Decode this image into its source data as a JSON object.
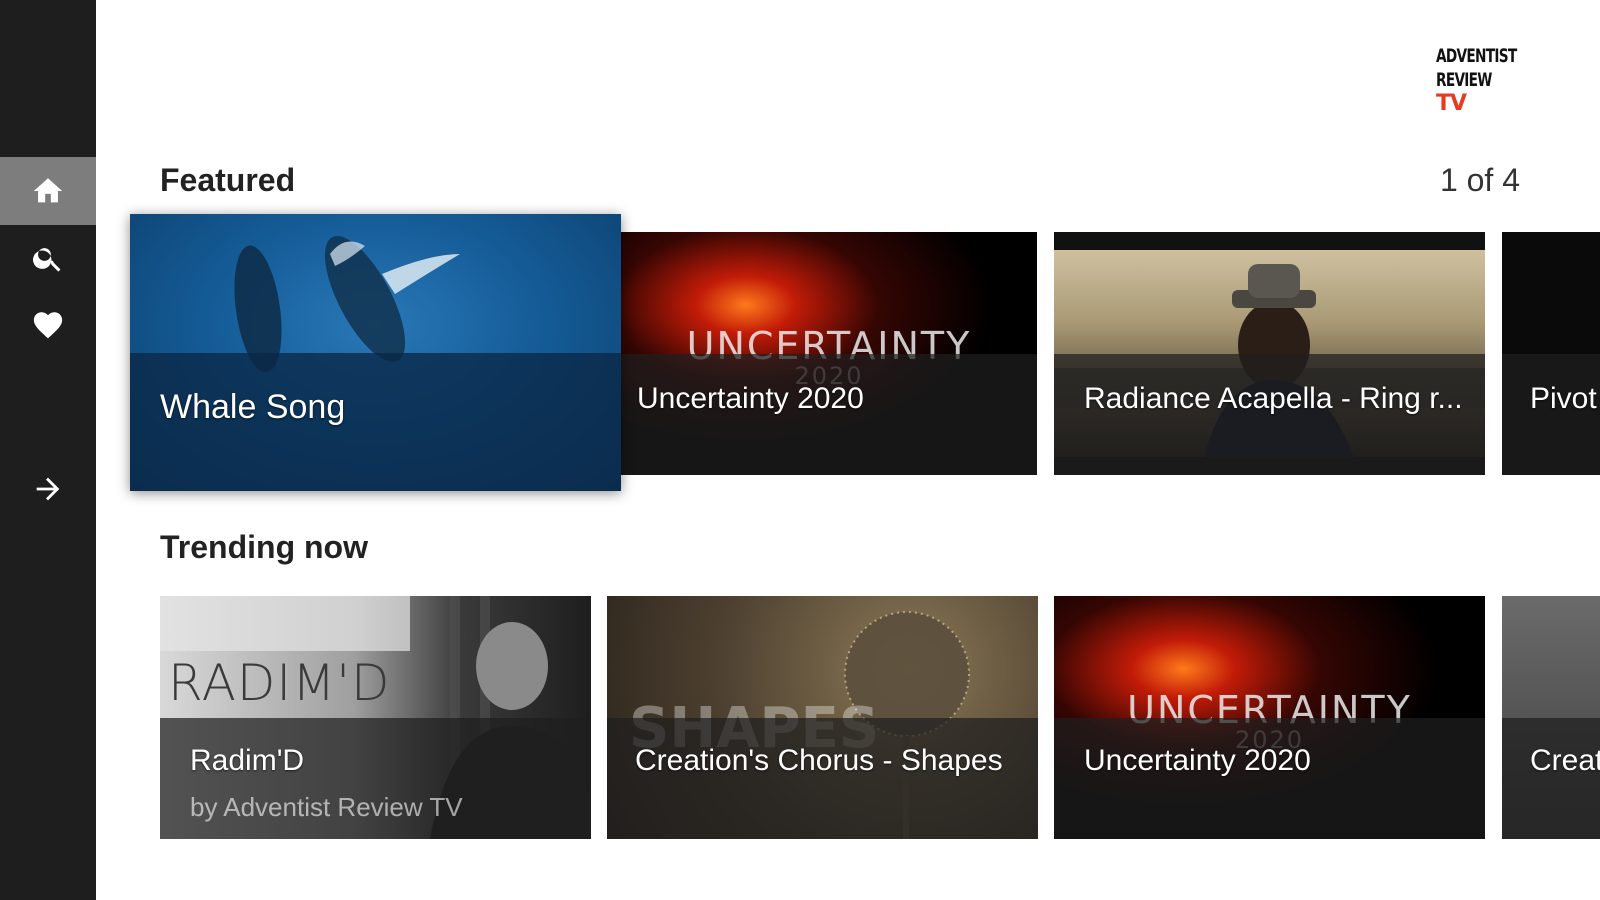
{
  "app": {
    "logo_line1": "ADVENTIST",
    "logo_line2": "REVIEW",
    "logo_line3": "TV",
    "accent_color": "#e53b1f"
  },
  "sidebar": {
    "items": [
      {
        "name": "home",
        "icon": "home-icon",
        "active": true
      },
      {
        "name": "search",
        "icon": "search-icon",
        "active": false
      },
      {
        "name": "favorites",
        "icon": "heart-icon",
        "active": false
      },
      {
        "name": "sign-in",
        "icon": "arrow-right-icon",
        "active": false
      }
    ]
  },
  "featured": {
    "title": "Featured",
    "page_indicator": "1 of 4",
    "items": [
      {
        "title": "Whale Song"
      },
      {
        "title": "Uncertainty 2020",
        "art_text": "UNCERTAINTY",
        "art_year": "2020"
      },
      {
        "title": "Radiance Acapella - Ring r..."
      },
      {
        "title": "Pivot"
      }
    ]
  },
  "trending": {
    "title": "Trending now",
    "items": [
      {
        "title": "Radim'D",
        "subtitle": "by Adventist Review TV",
        "art_text": "RADIM'D"
      },
      {
        "title": "Creation's Chorus - Shapes",
        "art_text": "SHAPES"
      },
      {
        "title": "Uncertainty 2020",
        "art_text": "UNCERTAINTY",
        "art_year": "2020"
      },
      {
        "title": "Creat"
      }
    ]
  }
}
